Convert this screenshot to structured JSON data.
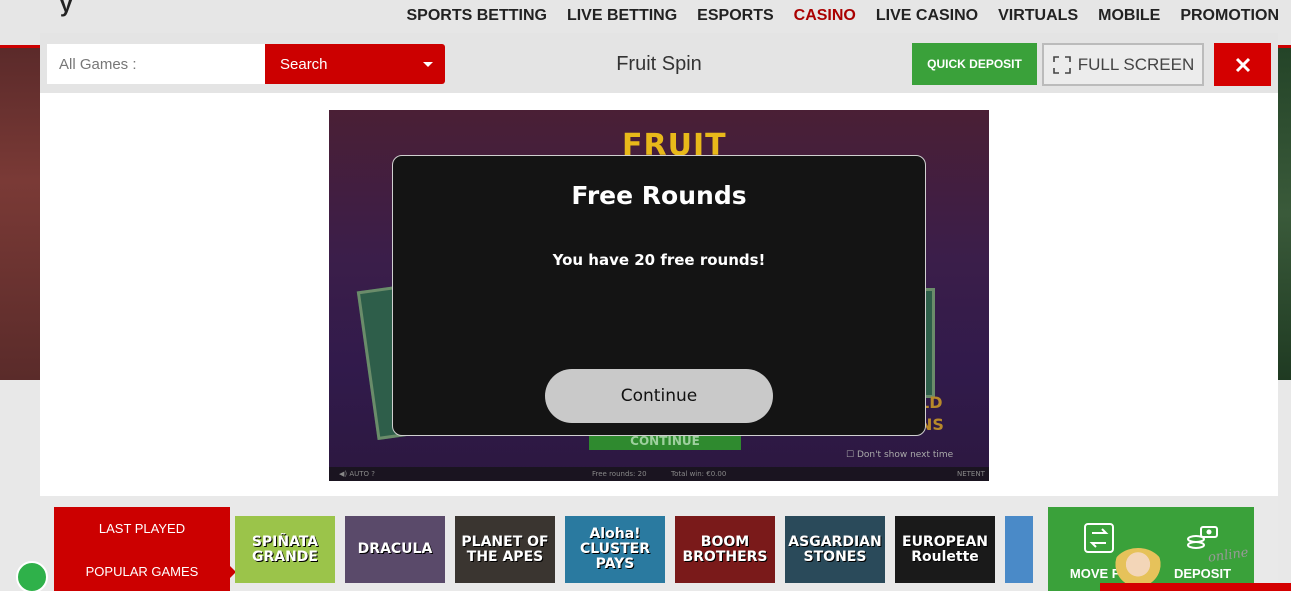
{
  "nav": {
    "items": [
      "SPORTS BETTING",
      "LIVE BETTING",
      "ESPORTS",
      "CASINO",
      "LIVE CASINO",
      "VIRTUALS",
      "MOBILE",
      "PROMOTION"
    ],
    "active": "CASINO"
  },
  "toolbar": {
    "search_placeholder": "All Games :",
    "search_label": "Search",
    "game_title": "Fruit Spin",
    "quick_deposit_label": "QUICK DEPOSIT",
    "full_screen_label": "FULL SCREEN",
    "close_icon": "close-icon"
  },
  "game": {
    "logo_text": "FRUIT",
    "wild_text_1": "LD",
    "wild_text_2": "NS",
    "behind_continue": "CONTINUE",
    "dont_show": "Don't show next time",
    "footer_auto": "AUTO",
    "footer_free_rounds": "Free rounds: 20",
    "footer_total_win": "Total win: €0.00",
    "footer_brand": "NETENT"
  },
  "free_rounds_dialog": {
    "title": "Free Rounds",
    "message": "You have 20 free rounds!",
    "continue_label": "Continue"
  },
  "bottom": {
    "last_played_label": "LAST PLAYED",
    "popular_label": "POPULAR GAMES",
    "thumbnails": [
      {
        "label": "SPIÑATA GRANDE",
        "color": "#9bc44a"
      },
      {
        "label": "DRACULA",
        "color": "#5a4a6a"
      },
      {
        "label": "PLANET OF THE APES",
        "color": "#3a3530"
      },
      {
        "label": "Aloha! CLUSTER PAYS",
        "color": "#2a7aa0"
      },
      {
        "label": "BOOM BROTHERS",
        "color": "#7a1a1a"
      },
      {
        "label": "ASGARDIAN STONES",
        "color": "#2a4a5a"
      },
      {
        "label": "EUROPEAN Roulette",
        "color": "#1a1a1a"
      },
      {
        "label": "",
        "color": "#4a8ac8"
      }
    ],
    "move_funds_label": "MOVE FU",
    "deposit_label": "DEPOSIT"
  },
  "chat": {
    "online_text": "online"
  }
}
